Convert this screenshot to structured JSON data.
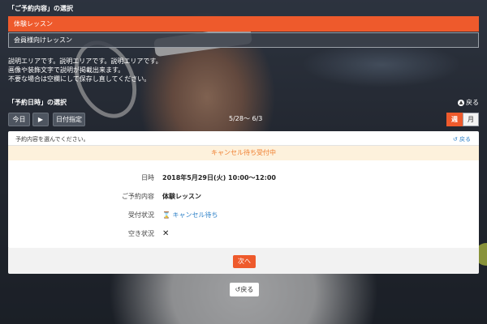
{
  "reservation": {
    "title": "「ご予約内容」の選択",
    "options": [
      "体験レッスン",
      "会員様向けレッスン"
    ],
    "description": [
      "説明エリアです。説明エリアです。説明エリアです。",
      "画像や装飾文字で説明が掲載出来ます。",
      "不要な場合は空欄にして保存し直してください。"
    ]
  },
  "datetime": {
    "title": "「予約日時」の選択",
    "back_label": "戻る",
    "today_label": "今日",
    "next_arrow": "▶",
    "date_pick_label": "日付指定",
    "range": "5/28～ 6/3",
    "week_label": "週",
    "month_label": "月"
  },
  "panel": {
    "prompt": "予約内容を選んでください。",
    "back_label": "戻る",
    "status_banner": "キャンセル待ち受付中",
    "rows": [
      {
        "label": "日時",
        "value": "2018年5月29日(火) 10:00～12:00"
      },
      {
        "label": "ご予約内容",
        "value": "体験レッスン"
      },
      {
        "label": "受付状況",
        "value": "キャンセル待ち"
      },
      {
        "label": "空き状況",
        "value": "✕"
      }
    ]
  },
  "footer": {
    "next_label": "次へ",
    "back_label": "戻る"
  }
}
